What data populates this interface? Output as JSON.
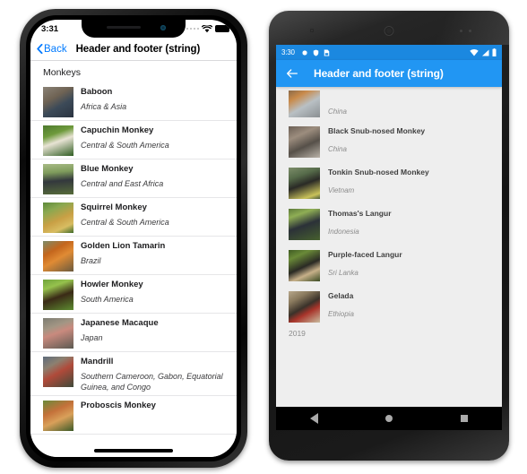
{
  "iphone": {
    "status": {
      "time": "3:31",
      "signal_icon": "signal-dots-icon",
      "wifi_icon": "wifi-icon",
      "battery_icon": "battery-icon"
    },
    "navbar": {
      "back_label": "Back",
      "back_icon": "chevron-left-icon",
      "title": "Header and footer (string)"
    },
    "list": {
      "header": "Monkeys",
      "items": [
        {
          "name": "Baboon",
          "region": "Africa & Asia",
          "thumb": "t-baboon"
        },
        {
          "name": "Capuchin Monkey",
          "region": "Central & South America",
          "thumb": "t-capuchin"
        },
        {
          "name": "Blue Monkey",
          "region": "Central and East Africa",
          "thumb": "t-blue"
        },
        {
          "name": "Squirrel Monkey",
          "region": "Central & South America",
          "thumb": "t-squirrel"
        },
        {
          "name": "Golden Lion Tamarin",
          "region": "Brazil",
          "thumb": "t-tamarin"
        },
        {
          "name": "Howler Monkey",
          "region": "South America",
          "thumb": "t-howler"
        },
        {
          "name": "Japanese Macaque",
          "region": "Japan",
          "thumb": "t-macaque"
        },
        {
          "name": "Mandrill",
          "region": "Southern Cameroon, Gabon, Equatorial Guinea, and Congo",
          "thumb": "t-mandrill"
        },
        {
          "name": "Proboscis Monkey",
          "region": "",
          "thumb": "t-proboscis"
        }
      ]
    },
    "home_indicator": "home-indicator"
  },
  "android": {
    "status": {
      "time": "3:30",
      "left_icons": [
        "gear-icon",
        "shield-icon",
        "sim-card-icon"
      ],
      "right_icons": [
        "wifi-icon",
        "cell-signal-icon",
        "battery-icon"
      ]
    },
    "appbar": {
      "back_icon": "arrow-back-icon",
      "title": "Header and footer (string)"
    },
    "list": {
      "items": [
        {
          "name": "",
          "region": "China",
          "thumb": "t-china1",
          "clipped": true
        },
        {
          "name": "Black Snub-nosed Monkey",
          "region": "China",
          "thumb": "t-blacksnub"
        },
        {
          "name": "Tonkin Snub-nosed Monkey",
          "region": "Vietnam",
          "thumb": "t-tonkin"
        },
        {
          "name": "Thomas's Langur",
          "region": "Indonesia",
          "thumb": "t-thomas"
        },
        {
          "name": "Purple-faced Langur",
          "region": "Sri Lanka",
          "thumb": "t-purple"
        },
        {
          "name": "Gelada",
          "region": "Ethiopia",
          "thumb": "t-gelada"
        }
      ],
      "footer": "2019"
    },
    "navbar": {
      "back_icon": "nav-back-triangle-icon",
      "home_icon": "nav-home-circle-icon",
      "recents_icon": "nav-recents-square-icon"
    }
  },
  "colors": {
    "android_appbar": "#2196F3",
    "android_statusbar": "#1B88E0",
    "android_list_bg": "#EEEEEE",
    "ios_accent": "#007AFF"
  }
}
